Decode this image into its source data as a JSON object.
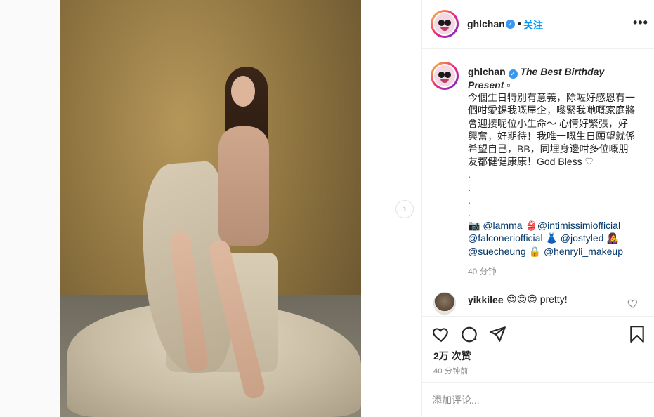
{
  "header": {
    "username": "ghlchan",
    "dot": "•",
    "follow_label": "关注",
    "more_label": "•••"
  },
  "caption": {
    "username": "ghlchan",
    "title_line1": "The Best Birthday",
    "title_line2": "Present",
    "title_glyph": "▫",
    "lines": [
      "今個生日特別有意義，除咗好感恩有一",
      "個咁愛錫我嘅屋企，嚟緊我哋嘅家庭將",
      "會迎接呢位小生命～ 心情好緊張，好",
      "興奮，好期待！我唯一嘅生日願望就係",
      "希望自己，BB，同埋身邊咁多位嘅朋",
      "友都健健康康！God Bless ♡"
    ],
    "dots": [
      ".",
      ".",
      ".",
      "."
    ],
    "camera_emoji": "📷",
    "mention1": "@lamma",
    "emoji1": "👙",
    "mention2": "@intimissimiofficial",
    "mention3": "@falconeriofficial",
    "emoji2": "👗",
    "mention4": "@jostyled",
    "emoji3": "👩‍🎤",
    "mention5": "@suecheung",
    "emoji4": "🔒",
    "mention6": "@henryli_makeup",
    "time": "40 分钟"
  },
  "comment": {
    "username": "yikkilee",
    "emojis": "😍😍😍",
    "text": "pretty!"
  },
  "likes": "2万 次赞",
  "post_time": "40 分钟前",
  "add_comment": {
    "placeholder": "添加评论..."
  },
  "next_arrow": "›",
  "verified_check": "✓",
  "icons": [
    "heart-icon",
    "comment-icon",
    "share-icon",
    "bookmark-icon",
    "chevron-right-icon",
    "more-icon",
    "verified-icon"
  ]
}
